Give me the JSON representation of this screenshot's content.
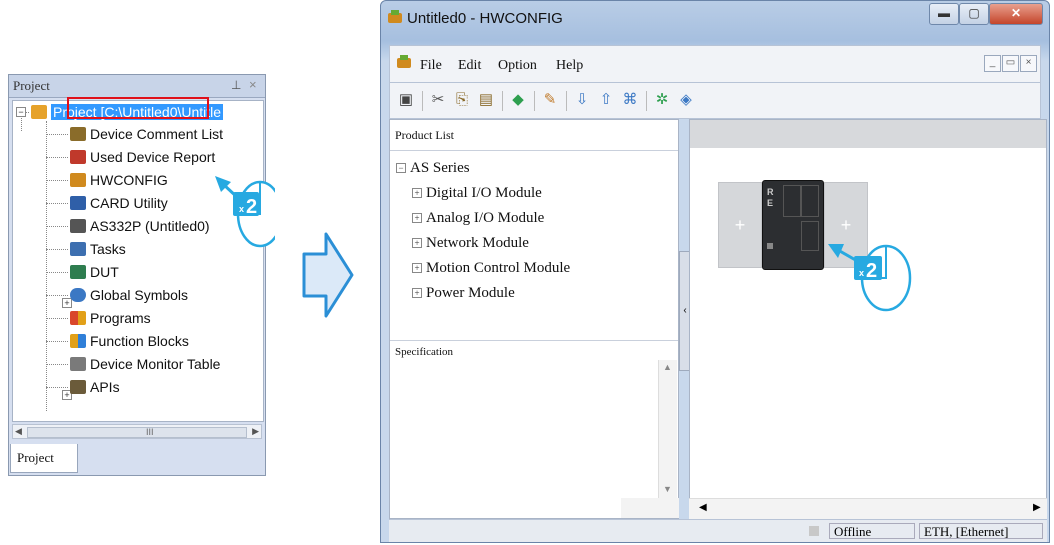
{
  "project_panel": {
    "title": "Project",
    "pin_icon": "pin-icon",
    "close_glyph": "×",
    "tab_label": "Project",
    "tree": [
      {
        "label": "Project [C:\\Untitled0\\Untitle",
        "icon": "project-icon",
        "color": "#3d7fd8",
        "selected": true
      },
      {
        "label": "Device Comment List",
        "icon": "comment-list-icon",
        "color": "#8a6c2a"
      },
      {
        "label": "Used Device Report",
        "icon": "report-icon",
        "color": "#c0392b"
      },
      {
        "label": "HWCONFIG",
        "icon": "hwconfig-icon",
        "color": "#d08a1e"
      },
      {
        "label": "CARD Utility",
        "icon": "card-icon",
        "color": "#2f5fa8"
      },
      {
        "label": "AS332P  (Untitled0)",
        "icon": "plc-icon",
        "color": "#555555"
      },
      {
        "label": "Tasks",
        "icon": "tasks-icon",
        "color": "#3d6fb0"
      },
      {
        "label": "DUT",
        "icon": "dut-icon",
        "color": "#2e7d4f"
      },
      {
        "label": "Global Symbols",
        "icon": "globe-icon",
        "color": "#3b78c4"
      },
      {
        "label": "Programs",
        "icon": "programs-icon",
        "color": "#d9472b"
      },
      {
        "label": "Function Blocks",
        "icon": "function-blocks-icon",
        "color": "#e2a018"
      },
      {
        "label": "Device Monitor Table",
        "icon": "monitor-icon",
        "color": "#7a7a7a"
      },
      {
        "label": "APIs",
        "icon": "api-icon",
        "color": "#6b5b3a"
      }
    ]
  },
  "callouts": {
    "double_click": "x2"
  },
  "window": {
    "title": "Untitled0 - HWCONFIG",
    "menu": [
      "File",
      "Edit",
      "Option",
      "Help"
    ],
    "product_list": {
      "header": "Product List",
      "series": "AS Series",
      "modules": [
        "Digital I/O Module",
        "Analog I/O Module",
        "Network Module",
        "Motion Control Module",
        "Power Module"
      ]
    },
    "specification_header": "Specification",
    "status": {
      "mode": "Offline",
      "connection": "ETH, [Ethernet]"
    },
    "cpu_leds": [
      "R",
      "E"
    ]
  },
  "colors": {
    "selection": "#3399ff",
    "highlight_box": "#e0101a",
    "arrow": "#27a9e1"
  }
}
